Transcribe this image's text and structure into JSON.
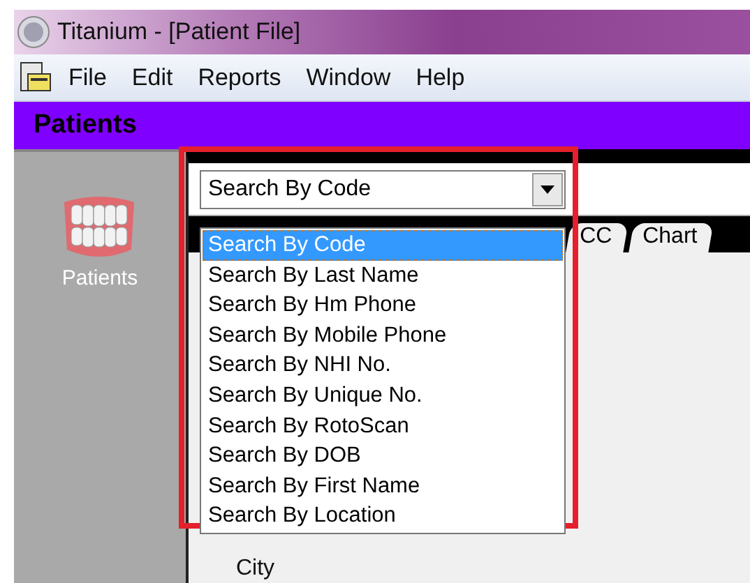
{
  "window": {
    "title": "Titanium - [Patient File]"
  },
  "menu": [
    {
      "label": "File"
    },
    {
      "label": "Edit"
    },
    {
      "label": "Reports"
    },
    {
      "label": "Window"
    },
    {
      "label": "Help"
    }
  ],
  "module_header": "Patients",
  "sidebar": {
    "items": [
      {
        "label": "Patients"
      }
    ]
  },
  "search": {
    "value": "Search By Code",
    "options": [
      {
        "label": "Search By Code",
        "selected": true
      },
      {
        "label": "Search By Last Name",
        "selected": false
      },
      {
        "label": "Search By Hm Phone",
        "selected": false
      },
      {
        "label": "Search By Mobile Phone",
        "selected": false
      },
      {
        "label": "Search By NHI No.",
        "selected": false
      },
      {
        "label": "Search By Unique No.",
        "selected": false
      },
      {
        "label": "Search By RotoScan",
        "selected": false
      },
      {
        "label": "Search By DOB",
        "selected": false
      },
      {
        "label": "Search By First Name",
        "selected": false
      },
      {
        "label": "Search By Location",
        "selected": false
      }
    ]
  },
  "tabs": [
    {
      "label": "CC"
    },
    {
      "label": "Chart"
    }
  ],
  "form": {
    "labels": [
      "City"
    ]
  }
}
